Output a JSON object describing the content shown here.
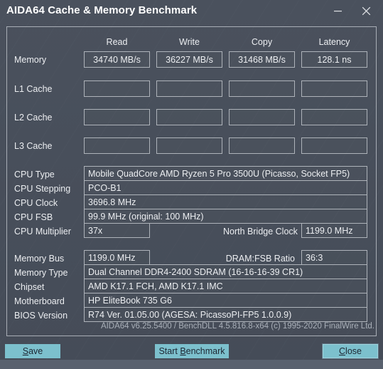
{
  "window": {
    "title": "AIDA64 Cache & Memory Benchmark",
    "minimize_icon": "minimize-icon",
    "close_icon": "close-icon"
  },
  "benchmark_table": {
    "columns": [
      "Read",
      "Write",
      "Copy",
      "Latency"
    ],
    "rows": [
      {
        "label": "Memory",
        "values": [
          "34740 MB/s",
          "36227 MB/s",
          "31468 MB/s",
          "128.1 ns"
        ]
      },
      {
        "label": "L1 Cache",
        "values": [
          "",
          "",
          "",
          ""
        ]
      },
      {
        "label": "L2 Cache",
        "values": [
          "",
          "",
          "",
          ""
        ]
      },
      {
        "label": "L3 Cache",
        "values": [
          "",
          "",
          "",
          ""
        ]
      }
    ]
  },
  "cpu_info": {
    "cpu_type_label": "CPU Type",
    "cpu_type_value": "Mobile QuadCore AMD Ryzen 5 Pro 3500U  (Picasso, Socket FP5)",
    "cpu_stepping_label": "CPU Stepping",
    "cpu_stepping_value": "PCO-B1",
    "cpu_clock_label": "CPU Clock",
    "cpu_clock_value": "3696.8 MHz",
    "cpu_fsb_label": "CPU FSB",
    "cpu_fsb_value": "99.9 MHz  (original: 100 MHz)",
    "cpu_multiplier_label": "CPU Multiplier",
    "cpu_multiplier_value": "37x",
    "north_bridge_clock_label": "North Bridge Clock",
    "north_bridge_clock_value": "1199.0 MHz"
  },
  "memory_info": {
    "memory_bus_label": "Memory Bus",
    "memory_bus_value": "1199.0 MHz",
    "dram_fsb_ratio_label": "DRAM:FSB Ratio",
    "dram_fsb_ratio_value": "36:3",
    "memory_type_label": "Memory Type",
    "memory_type_value": "Dual Channel DDR4-2400 SDRAM  (16-16-16-39 CR1)",
    "chipset_label": "Chipset",
    "chipset_value": "AMD K17.1 FCH, AMD K17.1 IMC",
    "motherboard_label": "Motherboard",
    "motherboard_value": "HP EliteBook 735 G6",
    "bios_version_label": "BIOS Version",
    "bios_version_value": "R74 Ver. 01.05.00  (AGESA: PicassoPI-FP5 1.0.0.9)"
  },
  "credit": "AIDA64 v6.25.5400 / BenchDLL 4.5.816.8-x64  (c) 1995-2020 FinalWire Ltd.",
  "buttons": {
    "save": {
      "prefix": "",
      "accel": "S",
      "suffix": "ave"
    },
    "start_benchmark": {
      "prefix": "Start ",
      "accel": "B",
      "suffix": "enchmark"
    },
    "close": {
      "prefix": "",
      "accel": "C",
      "suffix": "lose"
    }
  },
  "colors": {
    "window_bg": "#474e5a",
    "button_accent": "#7cc0cd",
    "field_border": "#aeb3ba",
    "text": "#eceef1",
    "muted_text": "#aab0b9"
  }
}
